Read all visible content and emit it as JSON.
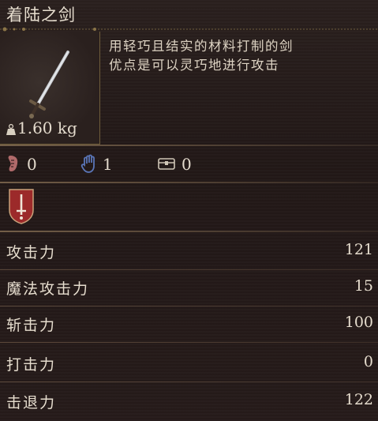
{
  "item": {
    "name": "着陆之剑",
    "weight": "1.60 kg",
    "description": [
      "用轻巧且结实的材料打制的剑",
      "优点是可以灵巧地进行攻击"
    ]
  },
  "requirements": [
    {
      "icon": "strength-icon",
      "value": "0"
    },
    {
      "icon": "dexterity-hand-icon",
      "value": "1"
    },
    {
      "icon": "chest-icon",
      "value": "0"
    }
  ],
  "weapon_type_icon": "sword-type-shield-icon",
  "stats": [
    {
      "label": "攻击力",
      "value": "121"
    },
    {
      "label": "魔法攻击力",
      "value": "15"
    },
    {
      "label": "斩击力",
      "value": "100"
    },
    {
      "label": "打击力",
      "value": "0"
    },
    {
      "label": "击退力",
      "value": "122"
    }
  ],
  "colors": {
    "background": "#231a19",
    "text": "#e4dbcd",
    "gold_trim": "#6f5d3b",
    "strength_red": "#b06a6a",
    "dexterity_blue": "#5a76b8",
    "badge_red": "#9c2a2a"
  }
}
